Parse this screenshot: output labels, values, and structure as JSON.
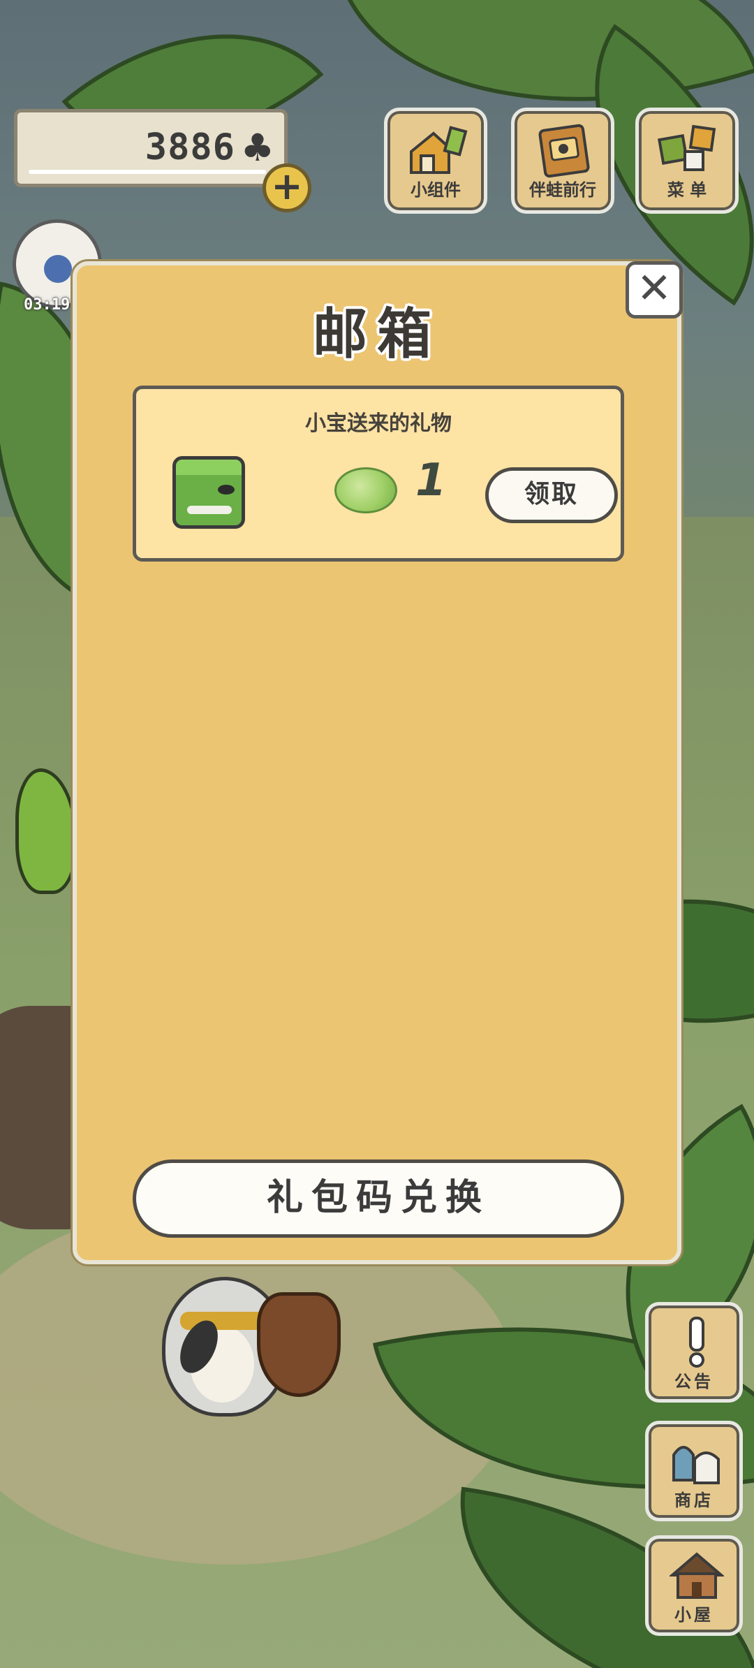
{
  "hud": {
    "clover_count": "3886",
    "clover_icon": "clover-icon",
    "add_icon": "plus-icon",
    "timer": "03:19",
    "buttons": [
      {
        "label": "小组件",
        "icon": "widget-icon"
      },
      {
        "label": "伴蛙前行",
        "icon": "book-icon"
      },
      {
        "label": "菜 单",
        "icon": "menu-cards-icon"
      }
    ]
  },
  "mailbox": {
    "title": "邮箱",
    "close_icon": "close-icon",
    "mails": [
      {
        "title": "小宝送来的礼物",
        "sender_icon": "frog-avatar-icon",
        "item_icon": "cabbage-icon",
        "quantity": "1",
        "claim_label": "领取"
      }
    ],
    "redeem_label": "礼包码兑换"
  },
  "side_buttons": [
    {
      "label": "公告",
      "icon": "exclamation-icon"
    },
    {
      "label": "商店",
      "icon": "shop-bags-icon"
    },
    {
      "label": "小屋",
      "icon": "house-icon"
    }
  ],
  "colors": {
    "panel_bg": "#ecc572",
    "card_bg": "#fde3a4",
    "button_bg": "#e6c98e",
    "outline": "#4e4c47"
  }
}
